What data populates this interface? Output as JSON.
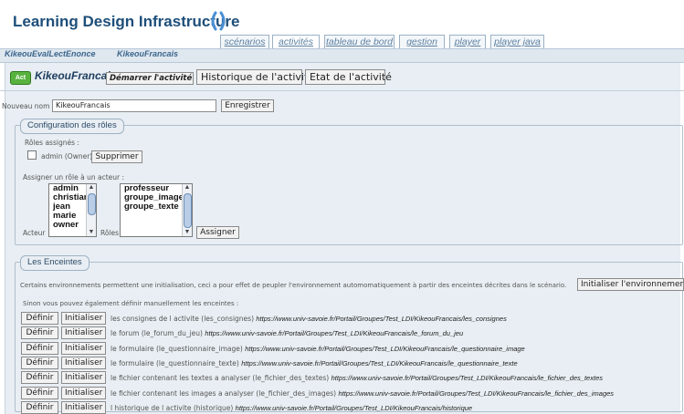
{
  "app": {
    "title": "Learning Design Infrastructure"
  },
  "tabs": [
    {
      "label": "scénarios",
      "active": false
    },
    {
      "label": "activités",
      "active": true
    },
    {
      "label": "tableau de bord",
      "active": false
    },
    {
      "label": "gestion",
      "active": false
    },
    {
      "label": "player",
      "active": false
    },
    {
      "label": "player java",
      "active": false
    }
  ],
  "breadcrumb": {
    "item1": "KikeouEvalLectEnonce",
    "item2": "KikeouFrancais"
  },
  "activity": {
    "badge": "Act",
    "name": "KikeouFrancais",
    "start_button": "Démarrer l'activité",
    "history_button": "Historique de l'activité",
    "state_button": "Etat de l'activité"
  },
  "rename": {
    "label": "Nouveau nom :",
    "value": "KikeouFrancais",
    "save_button": "Enregistrer"
  },
  "roles": {
    "legend": "Configuration des rôles",
    "assigned_label": "Rôles assignés :",
    "assigned_item": "admin (Owner)",
    "remove_button": "Supprimer",
    "assign_label": "Assigner un rôle à un acteur :",
    "actor_label": "Acteur",
    "actors": [
      "admin",
      "christian",
      "jean",
      "marie",
      "owner"
    ],
    "roles_label": "Rôles",
    "role_options": [
      "professeur",
      "groupe_image",
      "groupe_texte"
    ],
    "assign_button": "Assigner"
  },
  "enceintes": {
    "legend": "Les Enceintes",
    "intro": "Certains environnements permettent une initialisation, ceci a pour effet de peupler l'environnement automomatiquement à partir des enceintes décrites dans le scénario.",
    "init_env_button": "Initialiser l'environnement",
    "manual_note": "Sinon vous pouvez également définir manuellement les enceintes :",
    "define_label": "Définir",
    "init_label": "Initialiser",
    "rows": [
      {
        "desc": "les consignes de l activite (les_consignes)",
        "url": "https://www.univ-savoie.fr/Portail/Groupes/Test_LDI/KikeouFrancais/les_consignes"
      },
      {
        "desc": "le forum (le_forum_du_jeu)",
        "url": "https://www.univ-savoie.fr/Portail/Groupes/Test_LDI/KikeouFrancais/le_forum_du_jeu"
      },
      {
        "desc": "le formulaire (le_questionnaire_image)",
        "url": "https://www.univ-savoie.fr/Portail/Groupes/Test_LDI/KikeouFrancais/le_questionnaire_image"
      },
      {
        "desc": "le formulaire (le_questionnaire_texte)",
        "url": "https://www.univ-savoie.fr/Portail/Groupes/Test_LDI/KikeouFrancais/le_questionnaire_texte"
      },
      {
        "desc": "le fichier contenant les textes a analyser (le_fichier_des_textes)",
        "url": "https://www.univ-savoie.fr/Portail/Groupes/Test_LDI/KikeouFrancais/le_fichier_des_textes"
      },
      {
        "desc": "le fichier contenant les images a analyser (le_fichier_des_images)",
        "url": "https://www.univ-savoie.fr/Portail/Groupes/Test_LDI/KikeouFrancais/le_fichier_des_images"
      },
      {
        "desc": "l historique de l activite (historique)",
        "url": "https://www.univ-savoie.fr/Portail/Groupes/Test_LDI/KikeouFrancais/historique"
      }
    ]
  },
  "colors": {
    "accent": "#1d4e7a",
    "badge_green": "#58b23f",
    "band": "#e8eef3"
  }
}
